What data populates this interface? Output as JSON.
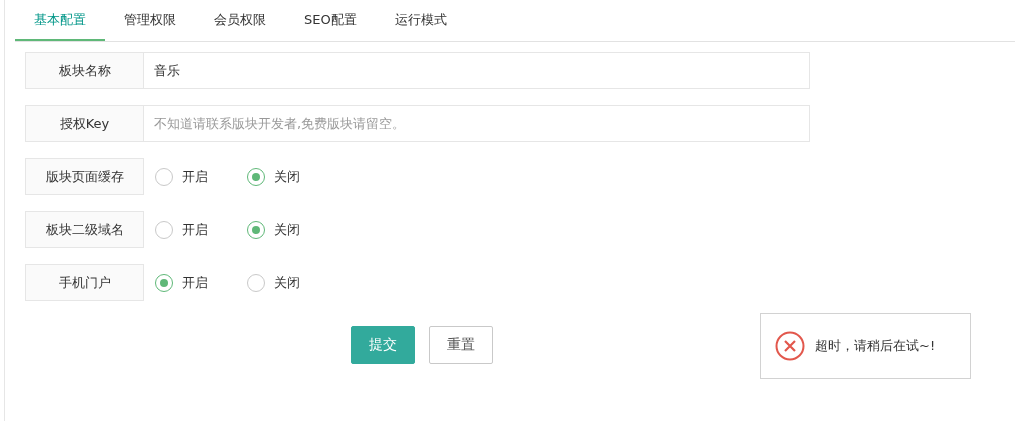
{
  "tabs": [
    {
      "label": "基本配置",
      "selected": true
    },
    {
      "label": "管理权限",
      "selected": false
    },
    {
      "label": "会员权限",
      "selected": false
    },
    {
      "label": "SEO配置",
      "selected": false
    },
    {
      "label": "运行模式",
      "selected": false
    }
  ],
  "fields": [
    {
      "kind": "text",
      "label": "板块名称",
      "value": "音乐"
    },
    {
      "kind": "text",
      "label": "授权Key",
      "placeholder": "不知道请联系版块开发者,免费版块请留空。"
    },
    {
      "kind": "radio",
      "label": "版块页面缓存",
      "options": [
        {
          "label": "开启",
          "selected": false
        },
        {
          "label": "关闭",
          "selected": true
        }
      ]
    },
    {
      "kind": "radio",
      "label": "板块二级域名",
      "options": [
        {
          "label": "开启",
          "selected": false
        },
        {
          "label": "关闭",
          "selected": true
        }
      ]
    },
    {
      "kind": "radio",
      "label": "手机门户",
      "options": [
        {
          "label": "开启",
          "selected": true
        },
        {
          "label": "关闭",
          "selected": false
        }
      ]
    }
  ],
  "buttons": [
    {
      "kind": "primary",
      "label": "提交"
    },
    {
      "kind": "plain",
      "label": "重置"
    }
  ],
  "toast": {
    "message": "超时，请稍后在试~!"
  }
}
